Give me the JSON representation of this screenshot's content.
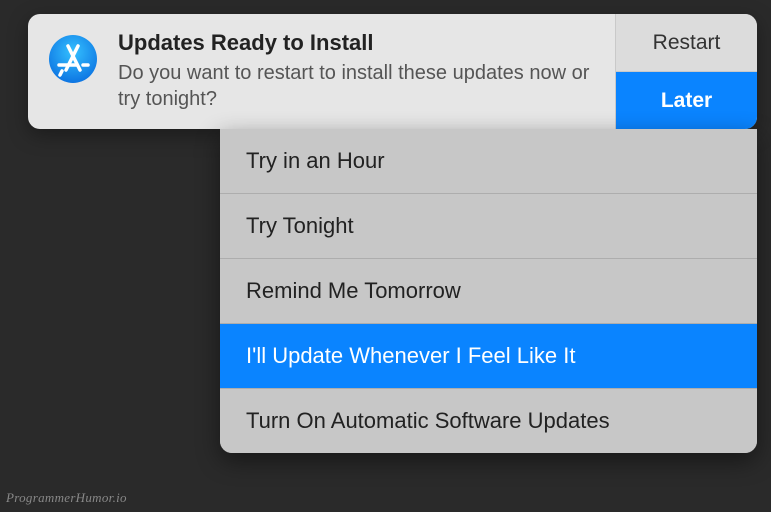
{
  "notification": {
    "title": "Updates Ready to Install",
    "message": "Do you want to restart to install these updates now or try tonight?",
    "icon": "app-store-icon",
    "actions": {
      "restart": "Restart",
      "later": "Later"
    }
  },
  "dropdown": {
    "items": [
      {
        "label": "Try in an Hour",
        "selected": false
      },
      {
        "label": "Try Tonight",
        "selected": false
      },
      {
        "label": "Remind Me Tomorrow",
        "selected": false
      },
      {
        "label": "I'll Update Whenever I Feel Like It",
        "selected": true
      },
      {
        "label": "Turn On Automatic Software Updates",
        "selected": false
      }
    ]
  },
  "watermark": "ProgrammerHumor.io",
  "colors": {
    "accent": "#0a84ff",
    "panel": "#e6e6e6",
    "dropdown": "#c7c7c7",
    "background": "#2a2a2a"
  }
}
